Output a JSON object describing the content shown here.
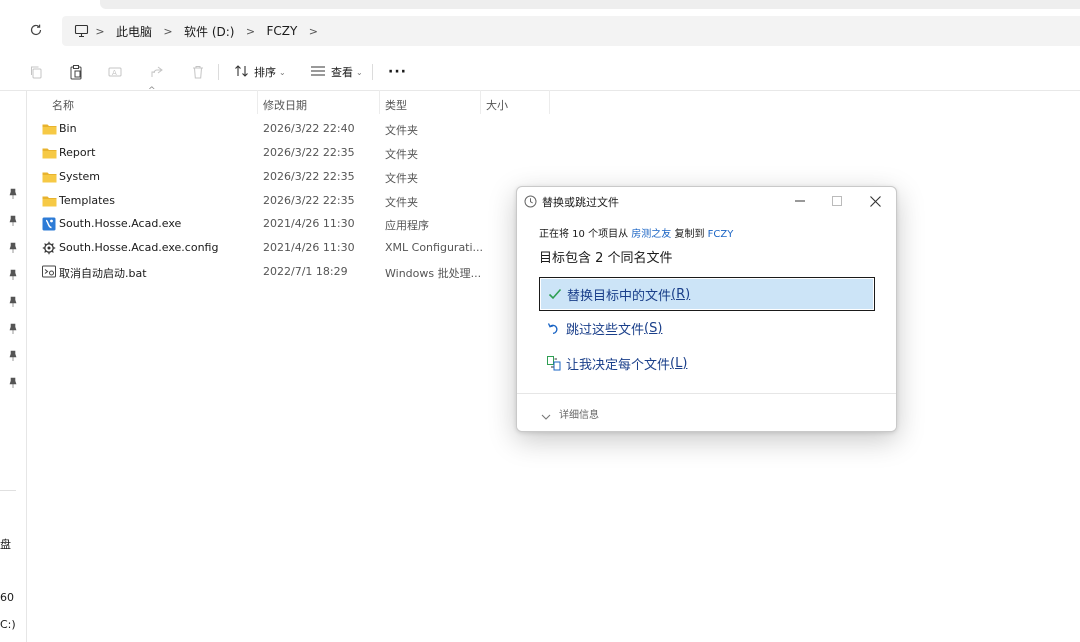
{
  "breadcrumb": {
    "items": [
      "此电脑",
      "软件 (D:)",
      "FCZY"
    ]
  },
  "toolbar": {
    "sort_label": "排序",
    "view_label": "查看",
    "more_label": "···"
  },
  "columns": {
    "name": "名称",
    "modified": "修改日期",
    "type": "类型",
    "size": "大小"
  },
  "files": [
    {
      "name": "Bin",
      "date": "2026/3/22 22:40",
      "type": "文件夹",
      "icon": "folder-icon"
    },
    {
      "name": "Report",
      "date": "2026/3/22 22:35",
      "type": "文件夹",
      "icon": "folder-icon"
    },
    {
      "name": "System",
      "date": "2026/3/22 22:35",
      "type": "文件夹",
      "icon": "folder-icon"
    },
    {
      "name": "Templates",
      "date": "2026/3/22 22:35",
      "type": "文件夹",
      "icon": "folder-icon"
    },
    {
      "name": "South.Hosse.Acad.exe",
      "date": "2021/4/26 11:30",
      "type": "应用程序",
      "icon": "exe-icon"
    },
    {
      "name": "South.Hosse.Acad.exe.config",
      "date": "2021/4/26 11:30",
      "type": "XML Configurati...",
      "icon": "config-icon"
    },
    {
      "name": "取消自动启动.bat",
      "date": "2022/7/1 18:29",
      "type": "Windows 批处理...",
      "icon": "bat-icon"
    }
  ],
  "nav_pane": {
    "fragments": [
      "盘",
      "60",
      "C:)"
    ]
  },
  "dialog": {
    "title": "替换或跳过文件",
    "sub_prefix": "正在将 10 个项目从",
    "sub_source": "房测之友",
    "sub_mid": "复制到",
    "sub_target": "FCZY",
    "heading": "目标包含 2 个同名文件",
    "options": [
      {
        "text": "替换目标中的文件",
        "key": "(R)"
      },
      {
        "text": "跳过这些文件",
        "key": "(S)"
      },
      {
        "text": "让我决定每个文件",
        "key": "(L)"
      }
    ],
    "details": "详细信息"
  },
  "colors": {
    "folder": "#e8b32e",
    "link": "#1a64c4",
    "selection": "#cce4f7",
    "check": "#2e9e52"
  }
}
